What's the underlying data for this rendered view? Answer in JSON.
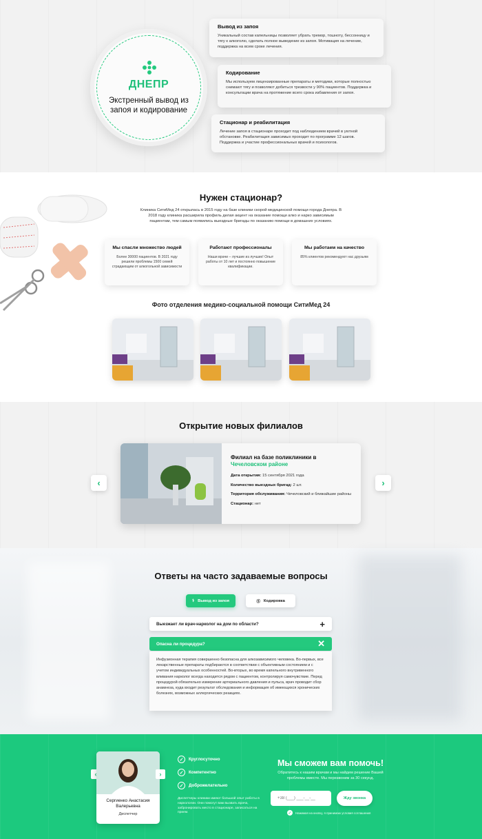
{
  "hero": {
    "city": "ДНЕПР",
    "title": "Экстренный вывод из запоя и кодирование",
    "cards": [
      {
        "title": "Вывод из запоя",
        "text": "Уникальный состав капельницы позволяет убрать тремор, тошноту, бессонницу и тягу к алкоголю, сделать полное выведение из запоя. Мотивация на лечение, поддержка на всем сроке лечения."
      },
      {
        "title": "Кодирование",
        "text": "Мы используем лицензированные препараты и методики, которые полностью снимают тягу и позволяют добиться трезвости у 90% пациентов. Поддержка и консультации врача на протяжение всего срока избавления от запоя."
      },
      {
        "title": "Стационар и реабилитация",
        "text": "Лечение запоя в стационаре проходит под наблюдением врачей в уютной обстановке. Реабилитация зависимых проходит по программе 12 шагов. Поддержка и участие профессиональных врачей и психологов."
      }
    ]
  },
  "stationary": {
    "title": "Нужен стационар?",
    "intro": "Клиника СитиМед 24 открылась в 2015 году на базе клиники скорой медицинской помощи города Днепра. В 2018 году клиника расширила профиль делая акцент на оказание помощи алко и нарко зависимым пациентам, тем самым появились выездные бригады по оказанию помощи в домашних условиях.",
    "stats": [
      {
        "title": "Мы спасли множество людей",
        "text": "Более 30000 пациентов. В 2021 году решили проблемы 1500 семей страдающим от алкогольной зависимости"
      },
      {
        "title": "Работают профессионалы",
        "text": "Наши врачи – лучшие из лучших! Опыт работы от 10 лет и постоянно повышение квалификации."
      },
      {
        "title": "Мы работаем на качество",
        "text": "85% клиентов рекомендуют нас друзьям"
      }
    ],
    "photos_title": "Фото отделения медико-социальной помощи СитиМед 24"
  },
  "branches": {
    "title": "Открытие новых филиалов",
    "card": {
      "title_prefix": "Филиал на базе поликлиники в",
      "title_highlight": "Чечеловском районе",
      "rows": [
        {
          "label": "Дата открытия:",
          "value": " 15 сентября 2021 года"
        },
        {
          "label": "Количество выездных бригад:",
          "value": " 2 шт."
        },
        {
          "label": "Территория обслуживания:",
          "value": " Чечеловский и ближайшие районы"
        },
        {
          "label": "Стационар:",
          "value": " нет"
        }
      ]
    }
  },
  "faq": {
    "title": "Ответы на часто задаваемые вопросы",
    "tabs": [
      "Вывод из запоя",
      "Кодировка"
    ],
    "q1": "Выезжает ли врач-нарколог на дом по области?",
    "q2": "Опасна ли процедура?",
    "answer": "Инфузионная терапия совершенно безопасна для алкозависимого человека. Во-первых, все лекарственные препараты подбираются в соответствии с объективным состоянием и с учетом индивидуальных особенностей. Во-вторых, во время капельного внутривенного вливания нарколог всегда находится рядом с пациентом, контролируя самочувствие. Перед процедурой обязательно измерение артериального давления и пульса, врач проводит сбор анамнеза, куда входит результат обследования и информация об имеющихся хронических болезнях, возможных аллергических реакциях."
  },
  "contact": {
    "person_name": "Сергиенко Анастасия Валерьевна",
    "person_role": "Диспетчер",
    "checks": [
      "Круглосуточно",
      "Компетентно",
      "Доброжелательно"
    ],
    "dispatcher_text": "Диспетчеры клиники имеют большой опыт работы в наркологии. Они помогут вам вызвать врача, забронировать место в стационаре, записаться на прием.",
    "title": "Мы сможем вам помочь!",
    "subtitle": "Обратитесь к нашим врачам и мы найдем решение Вашей проблемы вместе. Мы перезвоним за 30 секунд.",
    "phone_placeholder": "+38 (___) ___-__-__",
    "call_button": "Жду звонка",
    "agree": "Нажимая на кнопку, я принимаю условия соглашения"
  },
  "colors": {
    "accent": "#24c97e",
    "footer": "#1cc97e"
  }
}
